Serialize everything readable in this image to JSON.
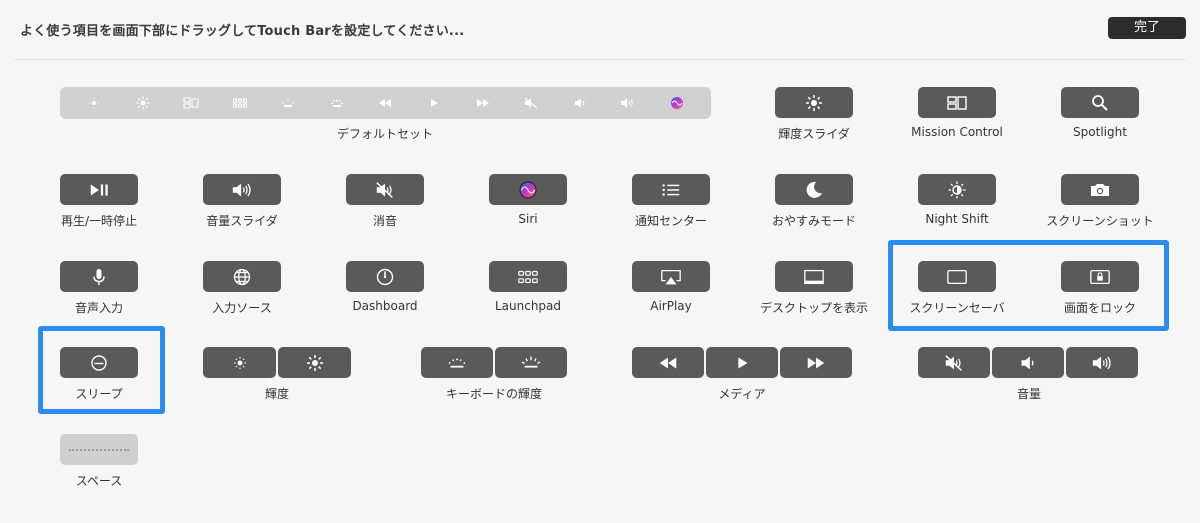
{
  "header": {
    "instruction": "よく使う項目を画面下部にドラッグしてTouch Barを設定してください...",
    "done_label": "完了"
  },
  "default_set": {
    "label": "デフォルトセット",
    "icons": [
      "brightness-down-icon",
      "brightness-up-icon",
      "mission-control-icon",
      "launchpad-icon",
      "keyboard-brightness-down-icon",
      "keyboard-brightness-up-icon",
      "rewind-icon",
      "play-icon",
      "fast-forward-icon",
      "mute-icon",
      "volume-down-icon",
      "volume-up-icon",
      "siri-icon"
    ]
  },
  "items": {
    "brightness_slider": "輝度スライダ",
    "mission_control": "Mission Control",
    "spotlight": "Spotlight",
    "play_pause": "再生/一時停止",
    "volume_slider": "音量スライダ",
    "mute": "消音",
    "siri": "Siri",
    "notification_center": "通知センター",
    "do_not_disturb": "おやすみモード",
    "night_shift": "Night Shift",
    "screenshot": "スクリーンショット",
    "dictation": "音声入力",
    "input_source": "入力ソース",
    "dashboard": "Dashboard",
    "launchpad": "Launchpad",
    "airplay": "AirPlay",
    "show_desktop": "デスクトップを表示",
    "screen_saver": "スクリーンセーバ",
    "lock_screen": "画面をロック",
    "sleep": "スリープ",
    "brightness": "輝度",
    "keyboard_brightness": "キーボードの輝度",
    "media": "メディア",
    "volume": "音量",
    "space": "スペース"
  },
  "colors": {
    "key": "#5a5a5a",
    "highlight": "#2a8cf2",
    "strip": "#d0d0d0"
  }
}
